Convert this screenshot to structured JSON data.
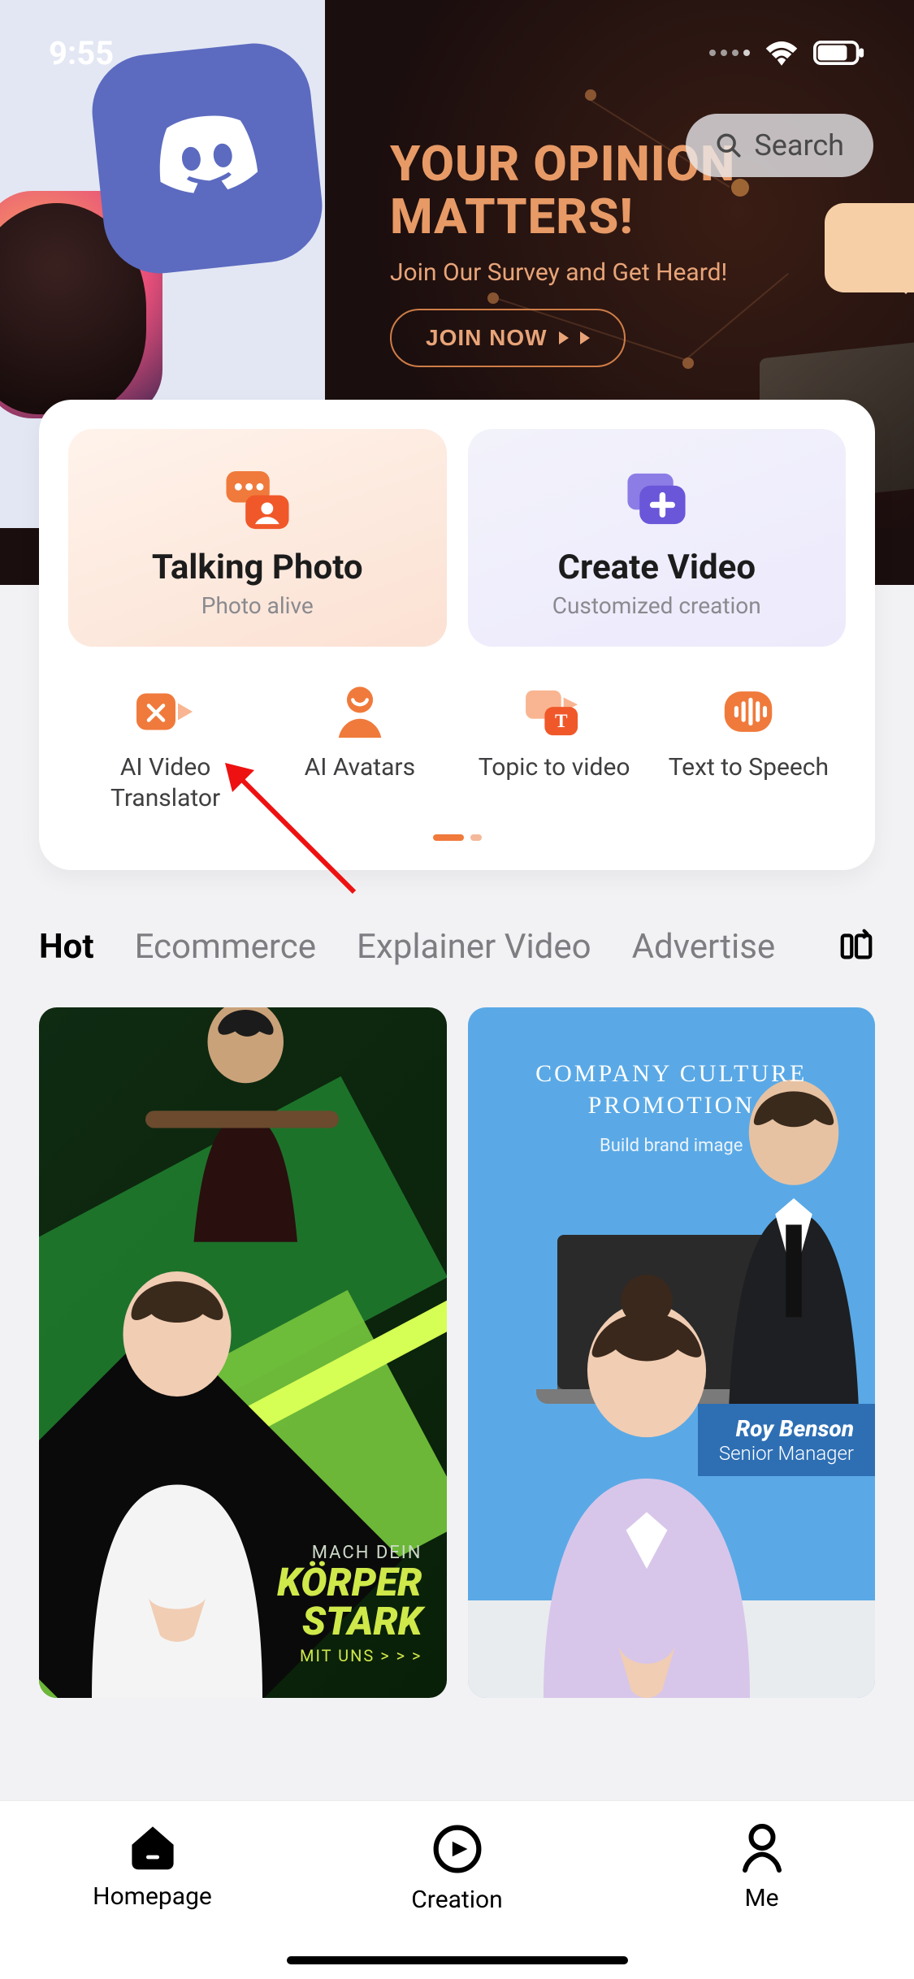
{
  "status": {
    "time": "9:55"
  },
  "banner": {
    "title_l1": "YOUR OPINION",
    "title_l2": "MATTERS!",
    "subtitle": "Join Our Survey and Get Heard!",
    "cta": "JOIN NOW"
  },
  "search": {
    "placeholder": "Search"
  },
  "main_tiles": [
    {
      "title": "Talking Photo",
      "sub": "Photo alive"
    },
    {
      "title": "Create Video",
      "sub": "Customized creation"
    }
  ],
  "small_tiles": [
    {
      "label_l1": "AI Video",
      "label_l2": "Translator"
    },
    {
      "label_l1": "AI Avatars",
      "label_l2": ""
    },
    {
      "label_l1": "Topic to video",
      "label_l2": ""
    },
    {
      "label_l1": "Text to Speech",
      "label_l2": ""
    }
  ],
  "tabs": {
    "items": [
      "Hot",
      "Ecommerce",
      "Explainer Video",
      "Advertise"
    ],
    "active_index": 0
  },
  "templates": {
    "gym": {
      "tag": "MACH DEIN",
      "line1": "KÖRPER",
      "line2": "STARK",
      "mit": "MIT UNS > > >"
    },
    "corp": {
      "title_l1": "COMPANY CULTURE",
      "title_l2": "PROMOTION",
      "sub": "Build brand image",
      "name": "Roy Benson",
      "role": "Senior Manager"
    }
  },
  "nav": {
    "items": [
      "Homepage",
      "Creation",
      "Me"
    ],
    "active_index": 0
  },
  "colors": {
    "accent": "#f07a3b",
    "discord": "#5c6bc0",
    "corp_blue": "#5aa9e6"
  }
}
